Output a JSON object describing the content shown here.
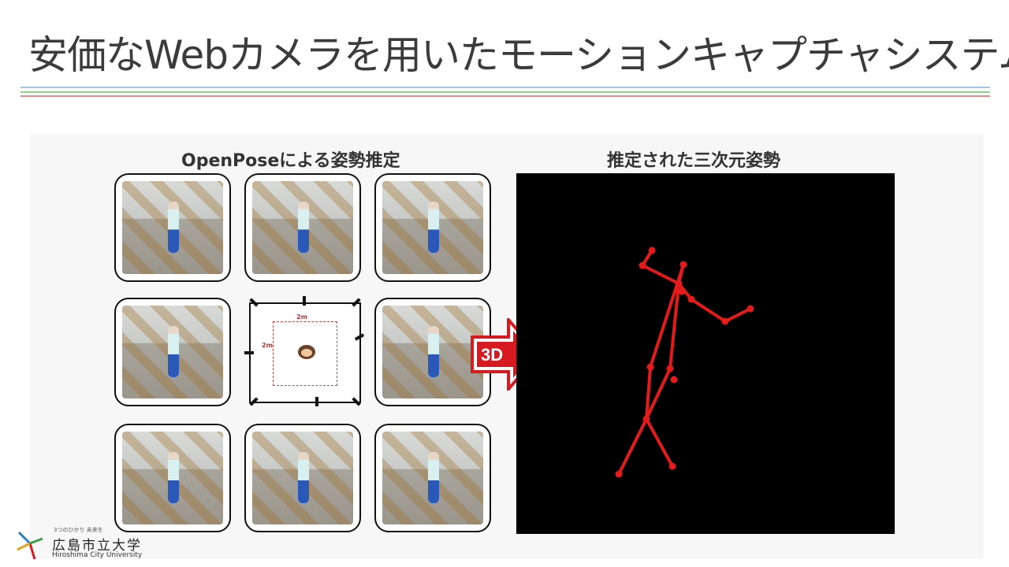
{
  "slide": {
    "title": "安価なWebカメラを用いたモーションキャプチャシステム"
  },
  "figure": {
    "left_heading": "OpenPoseによる姿勢推定",
    "right_heading": "推定された三次元姿勢",
    "arrow_label": "3D",
    "arena_width_label": "2m",
    "arena_height_label": "2m",
    "camera_count": 8,
    "skeleton_color": "#e51a1a"
  },
  "logo": {
    "motto": "3つのひかり 未来を",
    "name_ja": "広島市立大学",
    "name_en": "Hiroshima City University"
  }
}
